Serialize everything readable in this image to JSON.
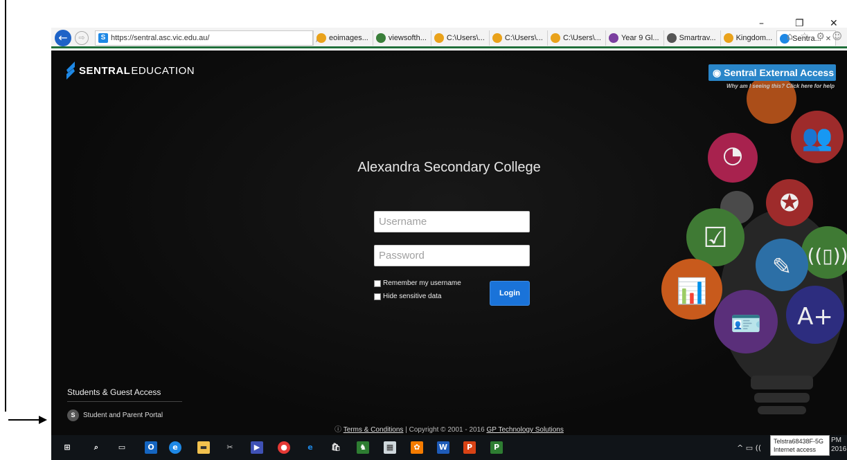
{
  "window_controls": {
    "minimize": "–",
    "restore": "❐",
    "close": "✕"
  },
  "browser": {
    "address": "https://sentral.asc.vic.edu.au/",
    "address_tools": "⌕ ▾ 🔒 ↻",
    "tabs": [
      {
        "label": "eoimages...",
        "icon": "ie-icon",
        "color": "#e9a21b"
      },
      {
        "label": "viewsofth...",
        "icon": "globe-icon",
        "color": "#3a7f3a"
      },
      {
        "label": "C:\\Users\\...",
        "icon": "ie-icon",
        "color": "#e9a21b"
      },
      {
        "label": "C:\\Users\\...",
        "icon": "ie-icon",
        "color": "#e9a21b"
      },
      {
        "label": "C:\\Users\\...",
        "icon": "ie-icon",
        "color": "#e9a21b"
      },
      {
        "label": "Year 9 Gl...",
        "icon": "onenote-icon",
        "color": "#7b3fa0"
      },
      {
        "label": "Smartrav...",
        "icon": "smartrav-icon",
        "color": "#555555"
      },
      {
        "label": "Kingdom...",
        "icon": "ie-icon",
        "color": "#e9a21b"
      },
      {
        "label": "Sentra...",
        "icon": "sentral-icon",
        "color": "#1e88e5",
        "active": true
      }
    ],
    "toolbar_icons": "⌂ ☆ ⚙ ☺"
  },
  "page": {
    "brand_name": "SENTRAL",
    "brand_sub": "EDUCATION",
    "external_access_button": "Sentral External Access",
    "external_access_help": "Why am I seeing this? Click here for help",
    "school_name": "Alexandra Secondary College",
    "username_placeholder": "Username",
    "password_placeholder": "Password",
    "remember_label": "Remember my username",
    "hide_label": "Hide sensitive data",
    "login_label": "Login",
    "guest_heading": "Students & Guest Access",
    "portal_label": "Student and Parent Portal",
    "footer_terms": "Terms & Conditions",
    "footer_copyright": "| Copyright © 2001 - 2016",
    "footer_company": "GP Technology Solutions"
  },
  "taskbar": {
    "wifi_name": "Telstra68438F-5G",
    "wifi_status": "Internet access",
    "clock_time": "PM",
    "clock_date": "2016"
  },
  "colors": {
    "accent_blue": "#2a86c9",
    "login_blue": "#1a73d9",
    "page_bg": "#0c0c0c",
    "circle_red": "#9e2b2b",
    "circle_green": "#3f7a34",
    "circle_blue": "#2c6fa6",
    "circle_orange": "#c85a1c",
    "circle_purple": "#5a2f7a"
  }
}
